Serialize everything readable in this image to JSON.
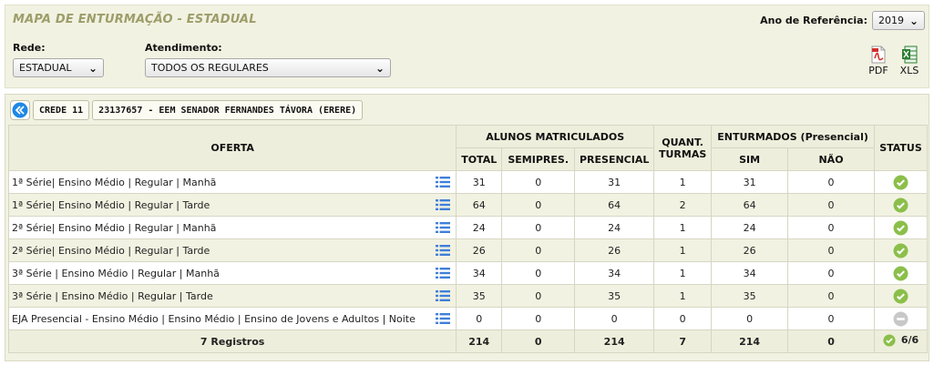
{
  "header": {
    "title": "MAPA DE ENTURMAÇÃO - ESTADUAL",
    "year_label": "Ano de Referência:",
    "year_value": "2019"
  },
  "filters": {
    "rede_label": "Rede:",
    "rede_value": "ESTADUAL",
    "atendimento_label": "Atendimento:",
    "atendimento_value": "TODOS OS REGULARES"
  },
  "exports": {
    "pdf_label": "PDF",
    "xls_label": "XLS"
  },
  "breadcrumb": {
    "crede": "CREDE 11",
    "school": "23137657 - EEM SENADOR FERNANDES TÁVORA (ERERE)"
  },
  "table": {
    "headers": {
      "oferta": "OFERTA",
      "alunos": "ALUNOS MATRICULADOS",
      "quant_line1": "QUANT.",
      "quant_line2": "TURMAS",
      "enturmados": "ENTURMADOS (Presencial)",
      "status": "STATUS",
      "total": "TOTAL",
      "semipres": "SEMIPRES.",
      "presencial": "PRESENCIAL",
      "sim": "SIM",
      "nao": "NÃO"
    },
    "rows": [
      {
        "oferta": "1ª Série| Ensino Médio | Regular | Manhã",
        "total": "31",
        "semipres": "0",
        "presencial": "31",
        "turmas": "1",
        "sim": "31",
        "nao": "0",
        "status": "ok"
      },
      {
        "oferta": "1ª Série| Ensino Médio | Regular | Tarde",
        "total": "64",
        "semipres": "0",
        "presencial": "64",
        "turmas": "2",
        "sim": "64",
        "nao": "0",
        "status": "ok"
      },
      {
        "oferta": "2ª Série| Ensino Médio | Regular | Manhã",
        "total": "24",
        "semipres": "0",
        "presencial": "24",
        "turmas": "1",
        "sim": "24",
        "nao": "0",
        "status": "ok"
      },
      {
        "oferta": "2ª Série| Ensino Médio | Regular | Tarde",
        "total": "26",
        "semipres": "0",
        "presencial": "26",
        "turmas": "1",
        "sim": "26",
        "nao": "0",
        "status": "ok"
      },
      {
        "oferta": "3ª Série | Ensino Médio | Regular | Manhã",
        "total": "34",
        "semipres": "0",
        "presencial": "34",
        "turmas": "1",
        "sim": "34",
        "nao": "0",
        "status": "ok"
      },
      {
        "oferta": "3ª Série | Ensino Médio | Regular | Tarde",
        "total": "35",
        "semipres": "0",
        "presencial": "35",
        "turmas": "1",
        "sim": "35",
        "nao": "0",
        "status": "ok"
      },
      {
        "oferta": "EJA Presencial - Ensino Médio | Ensino Médio | Ensino de Jovens e Adultos | Noite",
        "total": "0",
        "semipres": "0",
        "presencial": "0",
        "turmas": "0",
        "sim": "0",
        "nao": "0",
        "status": "none"
      }
    ],
    "footer": {
      "registros": "7 Registros",
      "total": "214",
      "semipres": "0",
      "presencial": "214",
      "turmas": "7",
      "sim": "214",
      "nao": "0",
      "status": "6/6"
    }
  },
  "colors": {
    "ok_green": "#8bbf4a",
    "inactive_gray": "#c8c8c8",
    "back_blue": "#1e88e5",
    "list_blue": "#3f7fd8"
  },
  "icons": {
    "status_ok": "check-circle-icon",
    "status_none": "minus-circle-icon",
    "row_action": "list-icon",
    "back": "double-chevron-left-icon"
  }
}
